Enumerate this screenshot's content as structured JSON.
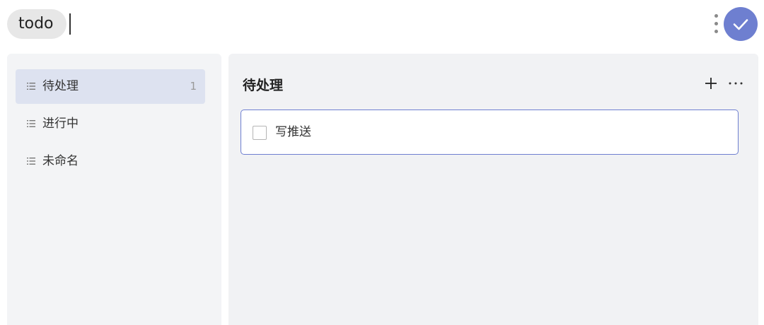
{
  "header": {
    "title": "todo",
    "more_icon": "more-vertical-icon",
    "confirm_icon": "check-icon",
    "accent_color": "#6e7fd0"
  },
  "sidebar": {
    "items": [
      {
        "label": "待处理",
        "count": "1",
        "icon": "list-icon",
        "active": true
      },
      {
        "label": "进行中",
        "count": "",
        "icon": "list-icon",
        "active": false
      },
      {
        "label": "未命名",
        "count": "",
        "icon": "list-icon",
        "active": false
      }
    ]
  },
  "main": {
    "title": "待处理",
    "add_icon": "plus-icon",
    "more_icon": "more-horizontal-icon",
    "tasks": [
      {
        "label": "写推送",
        "checked": false
      }
    ]
  }
}
